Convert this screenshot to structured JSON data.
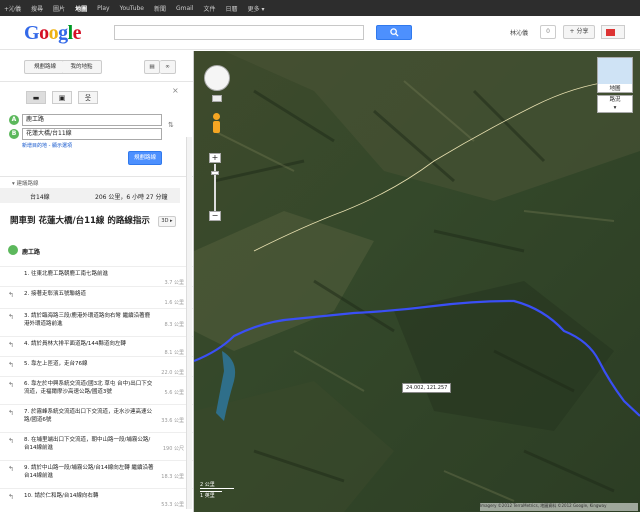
{
  "topbar": {
    "items": [
      "+沁儀",
      "搜尋",
      "圖片",
      "地圖",
      "Play",
      "YouTube",
      "新聞",
      "Gmail",
      "文件",
      "日曆",
      "更多 ▾"
    ],
    "active_index": 3
  },
  "header": {
    "logo": "Google",
    "search_value": "",
    "user_name": "林沁儀",
    "count": "0",
    "share_label": "+ 分享"
  },
  "panel": {
    "directions_btn": "規劃路線",
    "my_places_btn": "我的地點",
    "from": "鹿工路",
    "to": "花蓮大橋/台11線",
    "links": "新增目的地 - 顯示選項",
    "get_directions": "規劃路線",
    "suggested_label": "建議路線",
    "route_name": "台14線",
    "route_summary": "206 公里，6 小時 27 分鐘",
    "title": "開車到 花蓮大橋/台11線 的路線指示",
    "btn_3d": "3D ▸",
    "start_label": "鹿工路",
    "steps": [
      {
        "text": "1. 往東北鹿工路朝鹿工南七路前進",
        "dist": "3.7 公里"
      },
      {
        "text": "2. 接著走彰濱五號聯絡道",
        "dist": "1.6 公里"
      },
      {
        "text": "3. 請於臨海路三段/鹿港外環道路向右彎 繼續沿著鹿港外環道路前進",
        "dist": "8.3 公里"
      },
      {
        "text": "4. 請於員林大排平面道路/144縣道向左轉",
        "dist": "8.1 公里"
      },
      {
        "text": "5. 靠左上匝道，走台76線",
        "dist": "22.0 公里"
      },
      {
        "text": "6. 靠左於中興系統交流道(國3北 草屯 台中)出口下交流道，走福爾摩沙高速公路/國道3號",
        "dist": "5.6 公里"
      },
      {
        "text": "7. 於霧峰系統交流道出口下交流道，走水沙連高速公路/國道6號",
        "dist": "33.6 公里"
      },
      {
        "text": "8. 在埔里端出口下交流道，朝中山路一段/埔霧公路/台14線前進",
        "dist": "190 公尺"
      },
      {
        "text": "9. 請於中山路一段/埔霧公路/台14線向左轉 繼續沿著台14線前進",
        "dist": "18.3 公里"
      },
      {
        "text": "10. 請於仁和路/台14線向右轉",
        "dist": "53.3 公里"
      }
    ]
  },
  "map": {
    "layer_map": "地圖",
    "layer_traffic": "路況",
    "tooltip": "24.002, 121.257",
    "scale_metric": "2 公里",
    "scale_imperial": "1 英里",
    "copyright": "Imagery ©2012 TerraMetrics, 地圖資料 ©2012 Google, Kingway"
  },
  "colors": {
    "route": "#3a4ff5",
    "search_button": "#4d90fe",
    "marker": "#5cb85c"
  }
}
